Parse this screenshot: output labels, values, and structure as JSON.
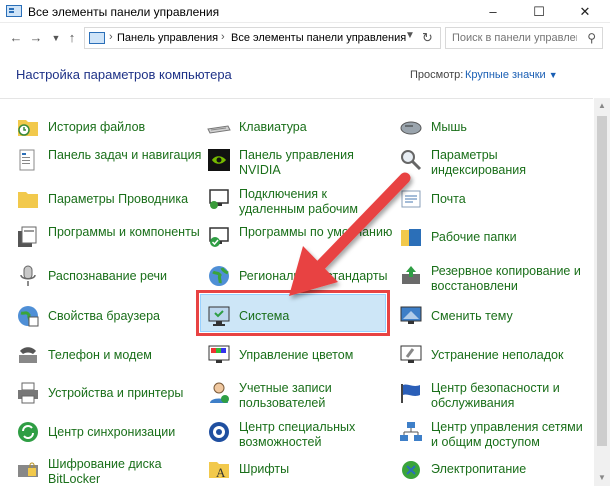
{
  "window": {
    "title": "Все элементы панели управления",
    "minimize_icon": "minimize-icon",
    "maximize_icon": "maximize-icon",
    "close_icon": "close-icon"
  },
  "address": {
    "crumbs": [
      "Панель управления",
      "Все элементы панели управления"
    ],
    "search_placeholder": "Поиск в панели управления"
  },
  "header": {
    "title": "Настройка параметров компьютера",
    "view_label": "Просмотр:",
    "view_value": "Крупные значки"
  },
  "items": [
    {
      "label": "История файлов",
      "icon": "file-history-icon"
    },
    {
      "label": "Клавиатура",
      "icon": "keyboard-icon"
    },
    {
      "label": "Мышь",
      "icon": "mouse-icon"
    },
    {
      "label": "Панель задач и навигация",
      "icon": "taskbar-icon"
    },
    {
      "label": "Панель управления NVIDIA",
      "icon": "nvidia-icon"
    },
    {
      "label": "Параметры индексирования",
      "icon": "indexing-icon"
    },
    {
      "label": "Параметры Проводника",
      "icon": "folder-options-icon"
    },
    {
      "label": "Подключения к удаленным рабочим",
      "icon": "remote-desktop-icon"
    },
    {
      "label": "Почта",
      "icon": "mail-icon"
    },
    {
      "label": "Программы и компоненты",
      "icon": "programs-icon"
    },
    {
      "label": "Программы по умолчанию",
      "icon": "default-programs-icon"
    },
    {
      "label": "Рабочие папки",
      "icon": "work-folders-icon"
    },
    {
      "label": "Распознавание речи",
      "icon": "microphone-icon"
    },
    {
      "label": "Региональные стандарты",
      "icon": "region-icon"
    },
    {
      "label": "Резервное копирование и восстановлени",
      "icon": "backup-icon"
    },
    {
      "label": "Свойства браузера",
      "icon": "internet-options-icon"
    },
    {
      "label": "Система",
      "icon": "system-icon"
    },
    {
      "label": "Сменить тему",
      "icon": "theme-icon"
    },
    {
      "label": "Телефон и модем",
      "icon": "phone-modem-icon"
    },
    {
      "label": "Управление цветом",
      "icon": "color-management-icon"
    },
    {
      "label": "Устранение неполадок",
      "icon": "troubleshooting-icon"
    },
    {
      "label": "Устройства и принтеры",
      "icon": "printer-icon"
    },
    {
      "label": "Учетные записи пользователей",
      "icon": "user-accounts-icon"
    },
    {
      "label": "Центр безопасности и обслуживания",
      "icon": "security-flag-icon"
    },
    {
      "label": "Центр синхронизации",
      "icon": "sync-center-icon"
    },
    {
      "label": "Центр специальных возможностей",
      "icon": "accessibility-icon"
    },
    {
      "label": "Центр управления сетями и общим доступом",
      "icon": "network-center-icon"
    },
    {
      "label": "Шифрование диска BitLocker",
      "icon": "bitlocker-icon"
    },
    {
      "label": "Шрифты",
      "icon": "fonts-icon"
    },
    {
      "label": "Электропитание",
      "icon": "power-icon"
    }
  ],
  "colors": {
    "link_green": "#1a6f1a",
    "heading_blue": "#1e3287",
    "selection_bg": "#cde6f7",
    "annotation_red": "#e84343"
  }
}
